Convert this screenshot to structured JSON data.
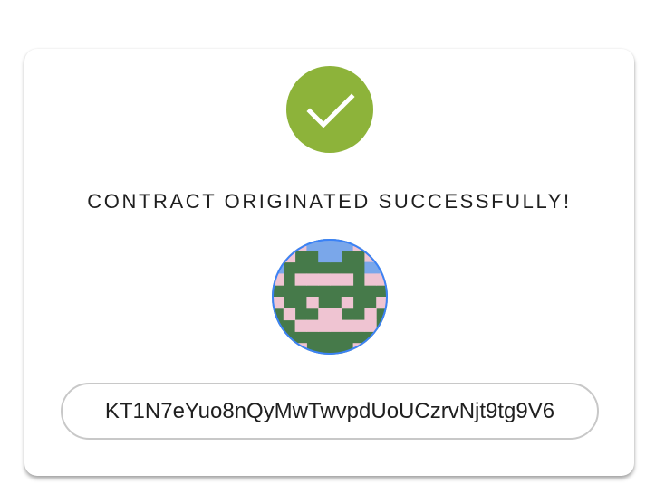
{
  "dialog": {
    "title": "CONTRACT ORIGINATED SUCCESSFULLY!",
    "contract_address": "KT1N7eYuo8nQyMwTwvpdUoUCzrvNjt9tg9V6"
  },
  "icons": {
    "success": "checkmark-icon",
    "identicon": "contract-identicon"
  },
  "colors": {
    "success": "#8db33a",
    "identicon_background": "#467a4a",
    "identicon_pink": "#efc4d2",
    "identicon_blue": "#7aa7ea",
    "identicon_border": "#3b82f6"
  },
  "identicon_pattern": [
    "pppbbbbppp",
    "ppggbbggpp",
    "bgggggggbb",
    "pgpppppgpp",
    "gggggggggg",
    "pggpggpggp",
    "gpggppggpg",
    "ggpppppppg",
    "pggggggggp",
    "pgpggggpgp"
  ]
}
